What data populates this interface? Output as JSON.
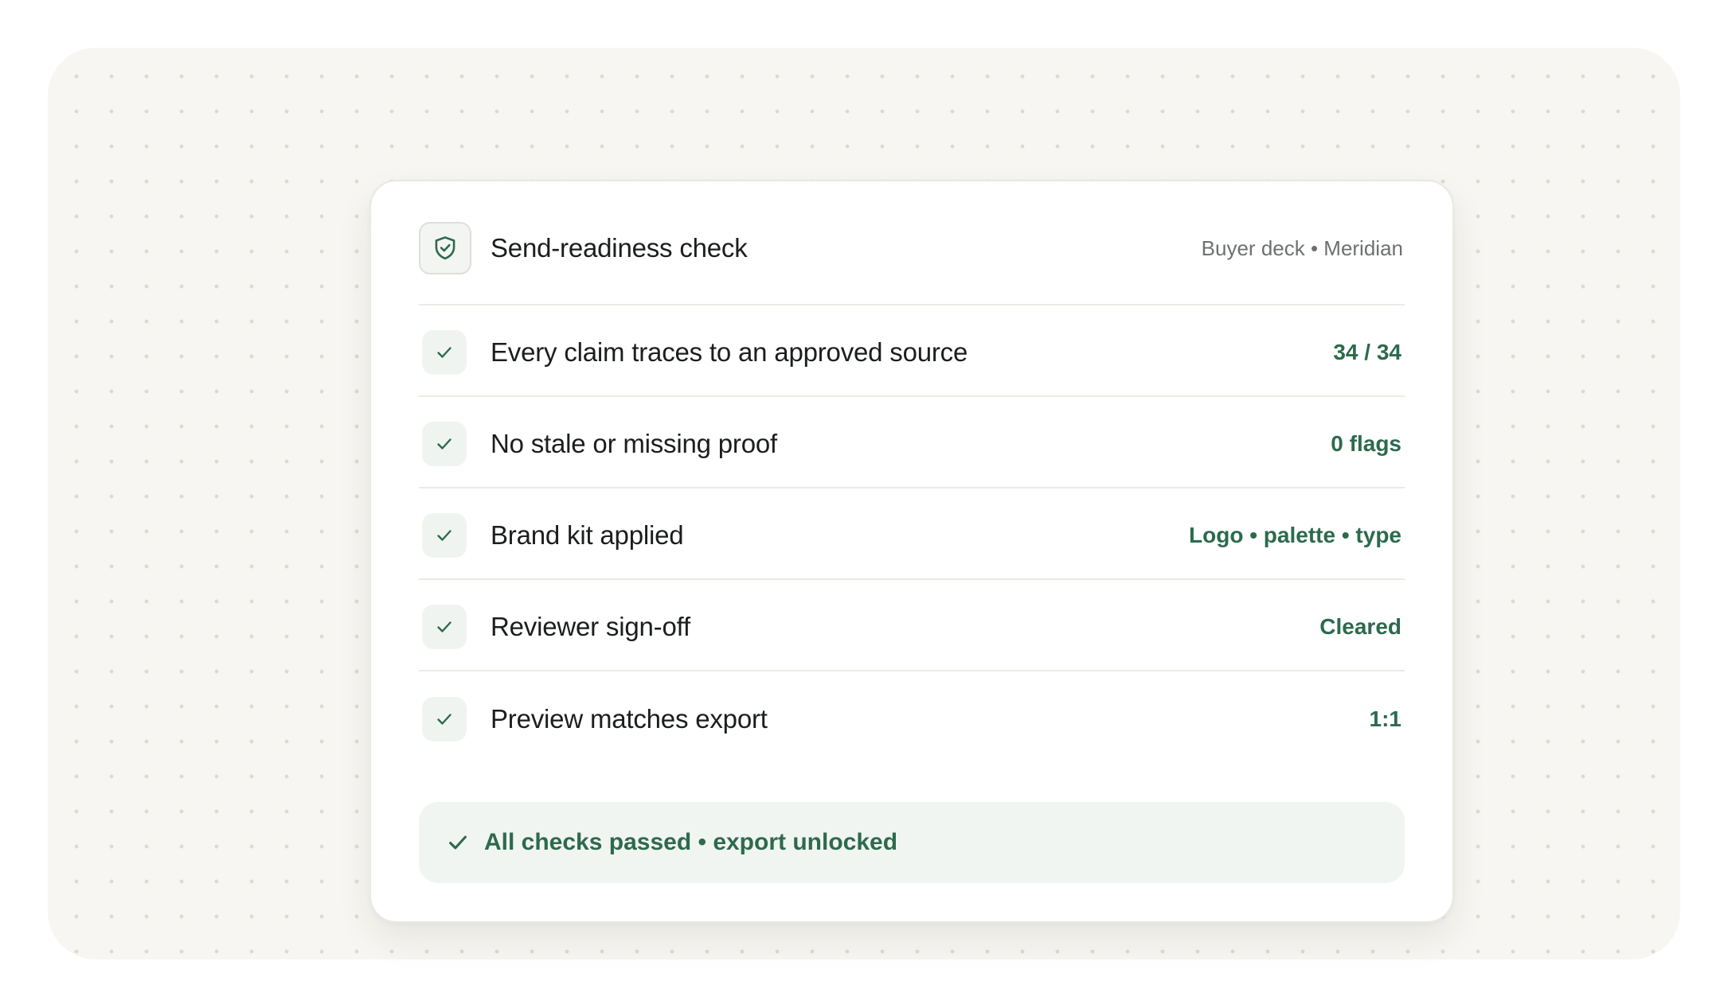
{
  "header": {
    "title": "Send-readiness check",
    "meta": "Buyer deck • Meridian",
    "icon": "shield-check-icon"
  },
  "checks": [
    {
      "label": "Every claim traces to an approved source",
      "value": "34 / 34",
      "status": "passed"
    },
    {
      "label": "No stale or missing proof",
      "value": "0 flags",
      "status": "passed"
    },
    {
      "label": "Brand kit applied",
      "value": "Logo • palette • type",
      "status": "passed"
    },
    {
      "label": "Reviewer sign-off",
      "value": "Cleared",
      "status": "passed"
    },
    {
      "label": "Preview matches export",
      "value": "1:1",
      "status": "passed"
    }
  ],
  "summary": {
    "text": "All checks passed • export unlocked",
    "icon": "check-icon"
  },
  "colors": {
    "accent": "#2d6a4d",
    "text": "#1b1e1c",
    "muted": "#6d716e",
    "background": "#f7f6f2",
    "tick_background": "#f0f4f1"
  }
}
